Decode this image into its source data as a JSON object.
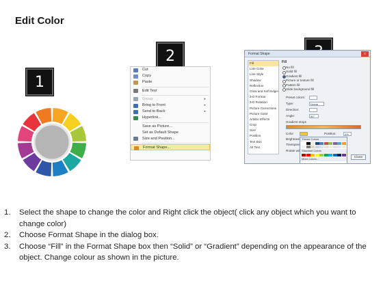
{
  "title": "Edit Color",
  "badges": [
    "1",
    "2",
    "3"
  ],
  "ring_colors": [
    "#f6a623",
    "#f7cf1e",
    "#a8c83a",
    "#3fae49",
    "#1ba7a2",
    "#1d7fc4",
    "#2f55a8",
    "#6c3d9e",
    "#a33b94",
    "#e2457b",
    "#e8353b",
    "#f07a22"
  ],
  "context_menu": {
    "items": [
      {
        "label": "Cut",
        "icon": "scissors-icon",
        "color": "#5a7fb8",
        "disabled": false,
        "submenu": false
      },
      {
        "label": "Copy",
        "icon": "copy-icon",
        "color": "#6b8fc6",
        "disabled": false,
        "submenu": false
      },
      {
        "label": "Paste",
        "icon": "paste-icon",
        "color": "#c8964a",
        "disabled": false,
        "submenu": false
      },
      {
        "sep": true
      },
      {
        "label": "Edit Text",
        "icon": "edit-text-icon",
        "color": "#7a7a7a",
        "disabled": false,
        "submenu": false
      },
      {
        "sep": true
      },
      {
        "label": "Group",
        "icon": "group-icon",
        "color": "#9aa6b8",
        "disabled": true,
        "submenu": true
      },
      {
        "label": "Bring to Front",
        "icon": "bring-front-icon",
        "color": "#3f6fb0",
        "disabled": false,
        "submenu": true
      },
      {
        "label": "Send to Back",
        "icon": "send-back-icon",
        "color": "#3f6fb0",
        "disabled": false,
        "submenu": true
      },
      {
        "label": "Hyperlink...",
        "icon": "hyperlink-icon",
        "color": "#3c8a4a",
        "disabled": false,
        "submenu": false
      },
      {
        "sep": true
      },
      {
        "label": "Save as Picture...",
        "icon": "",
        "color": "",
        "disabled": false,
        "submenu": false
      },
      {
        "label": "Set as Default Shape",
        "icon": "",
        "color": "",
        "disabled": false,
        "submenu": false
      },
      {
        "label": "Size and Position...",
        "icon": "size-icon",
        "color": "#6a7d99",
        "disabled": false,
        "submenu": false
      },
      {
        "sep": true
      },
      {
        "label": "Format Shape...",
        "icon": "format-shape-icon",
        "color": "#d98a2a",
        "disabled": false,
        "submenu": false,
        "highlight": true
      }
    ]
  },
  "dialog": {
    "title": "Format Shape",
    "close": "x",
    "nav": [
      "Fill",
      "Line Color",
      "Line Style",
      "Shadow",
      "Reflection",
      "Glow and Soft Edges",
      "3-D Format",
      "3-D Rotation",
      "Picture Corrections",
      "Picture Color",
      "Artistic Effects",
      "Crop",
      "Size",
      "Position",
      "Text Box",
      "Alt Text"
    ],
    "pane_title": "Fill",
    "fill_options": [
      "No fill",
      "Solid fill",
      "Gradient fill",
      "Picture or texture fill",
      "Pattern fill",
      "Slide background fill"
    ],
    "selected_fill": 2,
    "rows": {
      "preset": "Preset colors:",
      "type": "Type:",
      "type_value": "Linear",
      "direction": "Direction:",
      "angle": "Angle:",
      "angle_value": "90°",
      "stops": "Gradient stops",
      "color": "Color",
      "position": "Position:",
      "position_value": "0%",
      "brightness": "Brightness:",
      "transparency": "Transparency:",
      "rotate": "Rotate with shape"
    },
    "palette": {
      "header": "Theme Colors",
      "standard": "Standard Colors",
      "more": "More Colors...",
      "theme": [
        "#ffffff",
        "#000000",
        "#eeece1",
        "#1f497d",
        "#4f81bd",
        "#c0504d",
        "#9bbb59",
        "#8064a2",
        "#4bacc6",
        "#f79646",
        "#f2f2f2",
        "#7f7f7f",
        "#ddd9c3",
        "#c6d9f0",
        "#dbe5f1",
        "#f2dcdb",
        "#ebf1dd",
        "#e5e0ec",
        "#dbeef3",
        "#fdeada",
        "#d8d8d8",
        "#595959",
        "#c4bd97",
        "#8db3e2",
        "#b8cce4",
        "#e5b9b7",
        "#d7e3bc",
        "#ccc1d9",
        "#b7dde8",
        "#fbd5b5",
        "#bfbfbf",
        "#3f3f3f",
        "#938953",
        "#548dd4",
        "#95b3d7",
        "#d99694",
        "#c3d69b",
        "#b2a2c7",
        "#92cddc",
        "#fac08f",
        "#a5a5a5",
        "#262626",
        "#494429",
        "#17365d",
        "#366092",
        "#953734",
        "#76923c",
        "#5f497a",
        "#31859b",
        "#e36c09"
      ],
      "standard_colors": [
        "#c00000",
        "#ff0000",
        "#ffc000",
        "#ffff00",
        "#92d050",
        "#00b050",
        "#00b0f0",
        "#0070c0",
        "#002060",
        "#7030a0"
      ]
    },
    "close_button": "Close"
  },
  "steps": [
    {
      "num": "1.",
      "text": "Select the shape to change the color and Right click the object( click any object which you want to change color)"
    },
    {
      "num": "2.",
      "text": "Choose Format Shape in the dialog box."
    },
    {
      "num": "3.",
      "text": "Choose “Fill” in the Format Shape box then “Solid” or “Gradient” depending on the appearance of the object. Change colour as shown in the picture."
    }
  ]
}
